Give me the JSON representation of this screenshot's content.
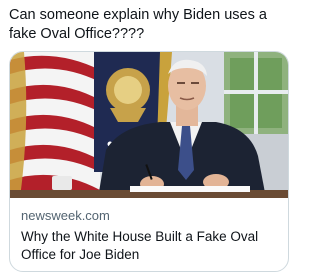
{
  "tweet": {
    "text": "Can someone explain why Biden uses a fake Oval Office????"
  },
  "link_card": {
    "image_alt": "Joe Biden seated at a desk in front of flags",
    "domain": "newsweek.com",
    "title": "Why the White House Built a Fake Oval Office for Joe Biden"
  }
}
